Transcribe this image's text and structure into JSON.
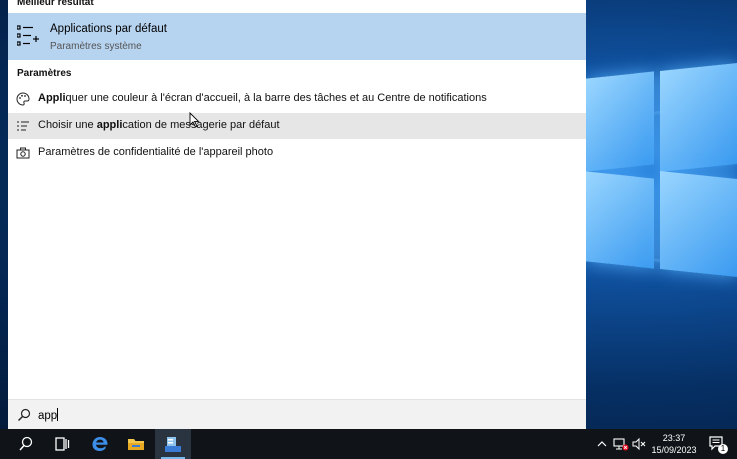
{
  "best_match": {
    "section_label": "Meilleur résultat",
    "title": "Applications par défaut",
    "subtitle": "Paramètres système"
  },
  "settings": {
    "section_label": "Paramètres",
    "items": [
      {
        "bold": "Appli",
        "rest": "quer une couleur à l'écran d'accueil, à la barre des tâches et au Centre de notifications",
        "icon": "palette-icon"
      },
      {
        "pre": "Choisir une ",
        "bold": "appli",
        "rest": "cation de messagerie par défaut",
        "icon": "list-settings-icon"
      },
      {
        "pre": "Paramètres de confidentialité de l'appareil photo",
        "icon": "camera-icon"
      }
    ]
  },
  "search": {
    "query": "app"
  },
  "taskbar": {
    "apps": [
      "search-icon",
      "task-view-icon",
      "edge-icon",
      "file-explorer-icon",
      "server-manager-icon"
    ]
  },
  "tray": {
    "time": "23:37",
    "date": "15/09/2023",
    "notification_count": "1"
  }
}
